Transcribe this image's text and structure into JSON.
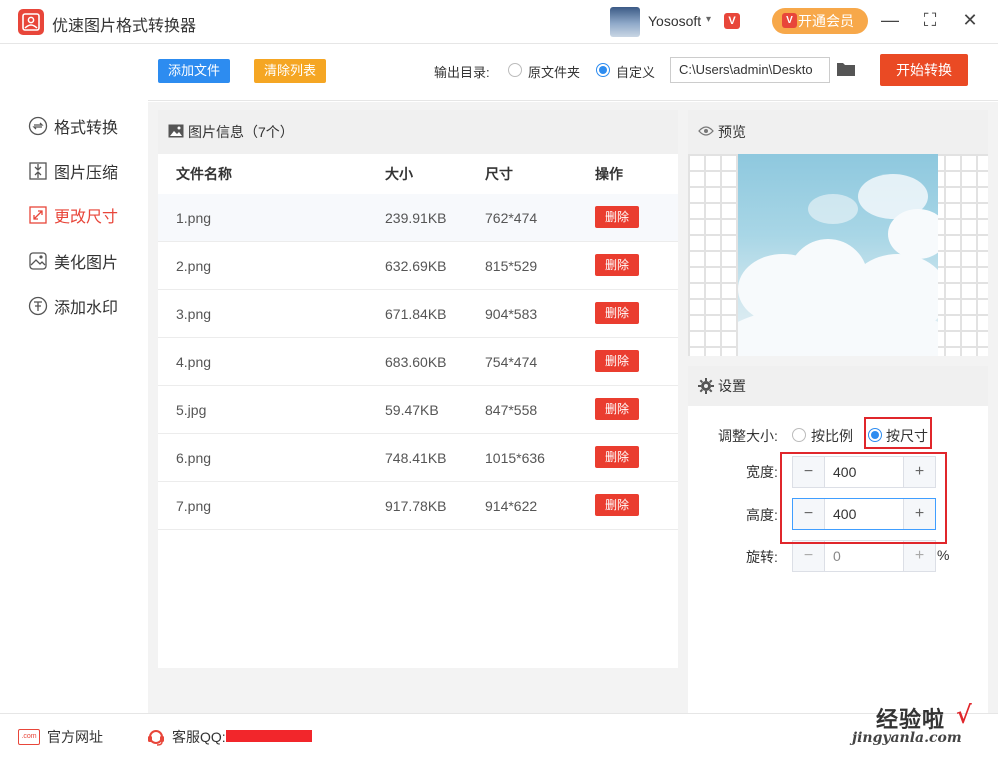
{
  "app": {
    "title": "优速图片格式转换器"
  },
  "user": {
    "name": "Yososoft",
    "vip_mini": "V"
  },
  "vip_button": {
    "badge": "V",
    "label": "开通会员"
  },
  "window_controls": {
    "minimize": "—",
    "maximize": "⛶",
    "close": "✕"
  },
  "sidebar": {
    "items": [
      {
        "label": "格式转换",
        "active": false
      },
      {
        "label": "图片压缩",
        "active": false
      },
      {
        "label": "更改尺寸",
        "active": true
      },
      {
        "label": "美化图片",
        "active": false
      },
      {
        "label": "添加水印",
        "active": false
      }
    ]
  },
  "toolbar": {
    "add_label": "添加文件",
    "clear_label": "清除列表",
    "output_label": "输出目录:",
    "option_original": "原文件夹",
    "option_custom": "自定义",
    "selected_option": "custom",
    "path_value": "C:\\Users\\admin\\Deskto",
    "start_label": "开始转换"
  },
  "file_panel": {
    "title": "图片信息（7个）",
    "columns": {
      "name": "文件名称",
      "size": "大小",
      "dimensions": "尺寸",
      "action": "操作"
    },
    "delete_label": "删除",
    "rows": [
      {
        "name": "1.png",
        "size": "239.91KB",
        "dims": "762*474"
      },
      {
        "name": "2.png",
        "size": "632.69KB",
        "dims": "815*529"
      },
      {
        "name": "3.png",
        "size": "671.84KB",
        "dims": "904*583"
      },
      {
        "name": "4.png",
        "size": "683.60KB",
        "dims": "754*474"
      },
      {
        "name": "5.jpg",
        "size": "59.47KB",
        "dims": "847*558"
      },
      {
        "name": "6.png",
        "size": "748.41KB",
        "dims": "1015*636"
      },
      {
        "name": "7.png",
        "size": "917.78KB",
        "dims": "914*622"
      }
    ]
  },
  "preview": {
    "title": "预览"
  },
  "settings": {
    "title": "设置",
    "resize_label": "调整大小:",
    "by_ratio": "按比例",
    "by_size": "按尺寸",
    "selected_mode": "by_size",
    "width_label": "宽度:",
    "width_value": "400",
    "height_label": "高度:",
    "height_value": "400",
    "rotate_label": "旋转:",
    "rotate_value": "0",
    "rotate_unit": "%",
    "minus": "−",
    "plus": "+"
  },
  "footer": {
    "site_icon_text": ".com",
    "site_label": "官方网址",
    "qq_label": "客服QQ:"
  },
  "watermark": {
    "line1": "经验啦",
    "line2": "jingyanla.com",
    "check": "√"
  },
  "colors": {
    "accent": "#e8463a",
    "blue": "#2d8cf0",
    "orange": "#f5a623",
    "start": "#ea4a24",
    "highlight": "#e0262b"
  }
}
